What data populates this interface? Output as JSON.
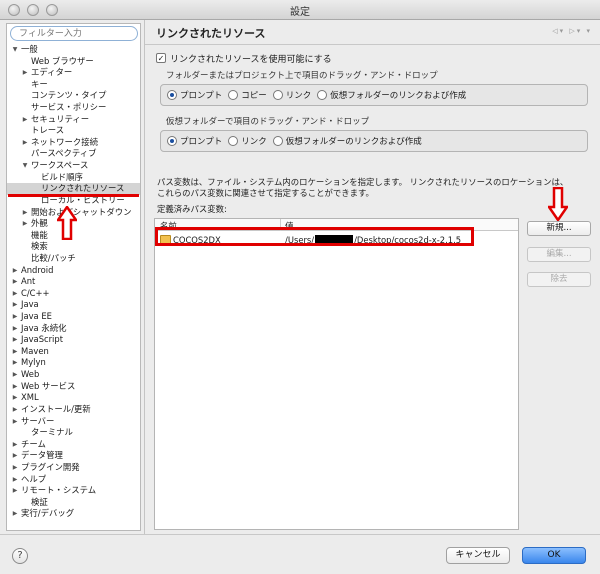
{
  "window": {
    "title": "設定"
  },
  "filter": {
    "placeholder": "フィルター入力"
  },
  "tree": [
    {
      "label": "一般",
      "level": 0,
      "state": "open"
    },
    {
      "label": "Web ブラウザー",
      "level": 1,
      "state": "leaf"
    },
    {
      "label": "エディター",
      "level": 1,
      "state": "closed"
    },
    {
      "label": "キー",
      "level": 1,
      "state": "leaf"
    },
    {
      "label": "コンテンツ・タイプ",
      "level": 1,
      "state": "leaf"
    },
    {
      "label": "サービス・ポリシー",
      "level": 1,
      "state": "leaf"
    },
    {
      "label": "セキュリティー",
      "level": 1,
      "state": "closed"
    },
    {
      "label": "トレース",
      "level": 1,
      "state": "leaf"
    },
    {
      "label": "ネットワーク接続",
      "level": 1,
      "state": "closed"
    },
    {
      "label": "パースペクティブ",
      "level": 1,
      "state": "leaf"
    },
    {
      "label": "ワークスペース",
      "level": 1,
      "state": "open"
    },
    {
      "label": "ビルド順序",
      "level": 2,
      "state": "leaf"
    },
    {
      "label": "リンクされたリソース",
      "level": 2,
      "state": "leaf",
      "selected": true
    },
    {
      "label": "ローカル・ヒストリー",
      "level": 2,
      "state": "leaf"
    },
    {
      "label": "開始およびシャットダウン",
      "level": 1,
      "state": "closed"
    },
    {
      "label": "外観",
      "level": 1,
      "state": "closed"
    },
    {
      "label": "機能",
      "level": 1,
      "state": "leaf"
    },
    {
      "label": "検索",
      "level": 1,
      "state": "leaf"
    },
    {
      "label": "比較/パッチ",
      "level": 1,
      "state": "leaf"
    },
    {
      "label": "Android",
      "level": 0,
      "state": "closed"
    },
    {
      "label": "Ant",
      "level": 0,
      "state": "closed"
    },
    {
      "label": "C/C++",
      "level": 0,
      "state": "closed"
    },
    {
      "label": "Java",
      "level": 0,
      "state": "closed"
    },
    {
      "label": "Java EE",
      "level": 0,
      "state": "closed"
    },
    {
      "label": "Java 永続化",
      "level": 0,
      "state": "closed"
    },
    {
      "label": "JavaScript",
      "level": 0,
      "state": "closed"
    },
    {
      "label": "Maven",
      "level": 0,
      "state": "closed"
    },
    {
      "label": "Mylyn",
      "level": 0,
      "state": "closed"
    },
    {
      "label": "Web",
      "level": 0,
      "state": "closed"
    },
    {
      "label": "Web サービス",
      "level": 0,
      "state": "closed"
    },
    {
      "label": "XML",
      "level": 0,
      "state": "closed"
    },
    {
      "label": "インストール/更新",
      "level": 0,
      "state": "closed"
    },
    {
      "label": "サーバー",
      "level": 0,
      "state": "closed"
    },
    {
      "label": "ターミナル",
      "level": 1,
      "state": "leaf"
    },
    {
      "label": "チーム",
      "level": 0,
      "state": "closed"
    },
    {
      "label": "データ管理",
      "level": 0,
      "state": "closed"
    },
    {
      "label": "プラグイン開発",
      "level": 0,
      "state": "closed"
    },
    {
      "label": "ヘルプ",
      "level": 0,
      "state": "closed"
    },
    {
      "label": "リモート・システム",
      "level": 0,
      "state": "closed"
    },
    {
      "label": "検証",
      "level": 1,
      "state": "leaf"
    },
    {
      "label": "実行/デバッグ",
      "level": 0,
      "state": "closed"
    }
  ],
  "page": {
    "title": "リンクされたリソース",
    "enable_label": "リンクされたリソースを使用可能にする",
    "enable_checked": true,
    "group1": {
      "label": "フォルダーまたはプロジェクト上で項目のドラッグ・アンド・ドロップ",
      "options": [
        "プロンプト",
        "コピー",
        "リンク",
        "仮想フォルダーのリンクおよび作成"
      ],
      "selected": 0
    },
    "group2": {
      "label": "仮想フォルダーで項目のドラッグ・アンド・ドロップ",
      "options": [
        "プロンプト",
        "リンク",
        "仮想フォルダーのリンクおよび作成"
      ],
      "selected": 0
    },
    "description_line1": "パス変数は、ファイル・システム内のロケーションを指定します。 リンクされたリソースのロケーションは、",
    "description_line2": "これらのパス変数に関連させて指定することができます。",
    "defined_label": "定義済みパス変数:",
    "table": {
      "col_name": "名前",
      "col_value": "値",
      "row_name": "COCOS2DX",
      "row_value_prefix": "/Users/",
      "row_value_suffix": "/Desktop/cocos2d-x-2.1.5"
    },
    "buttons": {
      "new": "新規...",
      "edit": "編集...",
      "remove": "除去"
    }
  },
  "bottom": {
    "help": "?",
    "cancel": "キャンセル",
    "ok": "OK"
  },
  "colors": {
    "accent": "#3a86ec",
    "annotation": "#e00000",
    "selection": "#d4d4d4"
  }
}
